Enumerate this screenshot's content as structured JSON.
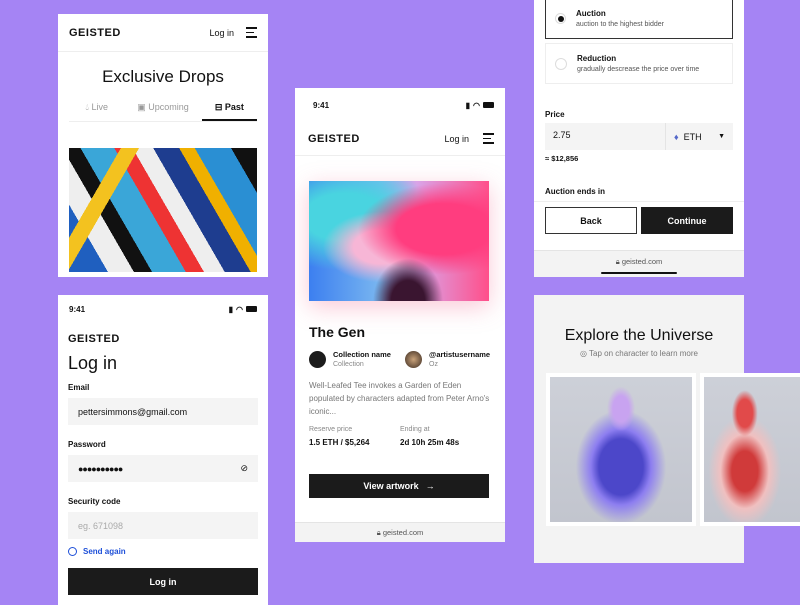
{
  "brand": "GEISTED",
  "drops": {
    "login": "Log in",
    "title": "Exclusive Drops",
    "tabs": [
      {
        "label": "Live",
        "icon": "drop-icon"
      },
      {
        "label": "Upcoming",
        "icon": "calendar-icon"
      },
      {
        "label": "Past",
        "icon": "archive-icon"
      }
    ],
    "active_tab": "Past"
  },
  "login": {
    "time": "9:41",
    "title": "Log in",
    "email_label": "Email",
    "email_value": "pettersimmons@gmail.com",
    "password_label": "Password",
    "password_value": "●●●●●●●●●●",
    "code_label": "Security code",
    "code_placeholder": "eg. 671098",
    "send_again": "Send again",
    "submit": "Log in"
  },
  "artwork": {
    "time": "9:41",
    "login": "Log in",
    "title": "The Gen",
    "collection_name": "Collection name",
    "collection_sub": "Collection",
    "artist": "@artistusername",
    "artist_sub": "Oz",
    "description": "Well-Leafed Tee invokes a Garden of Eden populated by characters adapted from Peter Arno's iconic...",
    "reserve_label": "Reserve price",
    "reserve_value": "1.5 ETH / $5,264",
    "ending_label": "Ending at",
    "ending_value": "2d 10h 25m 48s",
    "cta": "View artwork",
    "url": "geisted.com"
  },
  "listing": {
    "options": [
      {
        "title": "Auction",
        "desc": "auction to the highest bidder",
        "selected": true
      },
      {
        "title": "Reduction",
        "desc": "gradually descrease the price over time",
        "selected": false
      }
    ],
    "price_label": "Price",
    "price_value": "2.75",
    "currency": "ETH",
    "usd": "≈ $12,856",
    "ends_label": "Auction ends in",
    "back": "Back",
    "continue": "Continue",
    "url": "geisted.com"
  },
  "explore": {
    "title": "Explore the Universe",
    "hint": "Tap on character to learn more"
  },
  "colors": {
    "background": "#a584f4",
    "dark": "#1b1b1b",
    "link": "#1d4fd8"
  }
}
